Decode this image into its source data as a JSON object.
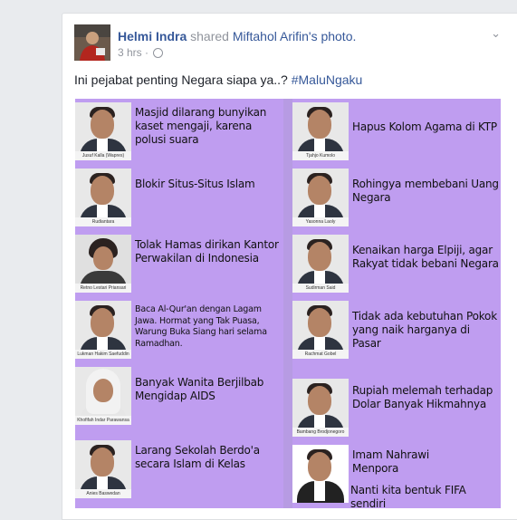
{
  "post": {
    "author": "Helmi Indra",
    "action": " shared ",
    "source_name": "Miftahol Arifin",
    "source_suffix": "'s photo.",
    "time": "3 hrs",
    "meta_sep": " · ",
    "caption": "Ini pejabat penting Negara siapa ya..? ",
    "hashtag": "#MaluNgaku"
  },
  "left_column": [
    {
      "caption": "Jusuf Kalla (Wapres)",
      "text": "Masjid dilarang bunyikan kaset mengaji, karena polusi suara"
    },
    {
      "caption": "Rudiantara",
      "text": "Blokir Situs-Situs Islam"
    },
    {
      "caption": "Retno Lestari Priansari Marsudi",
      "text": "Tolak Hamas dirikan Kantor Perwakilan di Indonesia"
    },
    {
      "caption": "Lukman Hakim Saefuddin",
      "text": "Baca Al-Qur'an dengan Lagam Jawa. Hormat yang Tak Puasa, Warung Buka Siang hari selama Ramadhan."
    },
    {
      "caption": "Khofifah Indar Parawansa",
      "text": "Banyak Wanita Berjilbab Mengidap AIDS"
    },
    {
      "caption": "Anies Baswedan",
      "text": "Larang Sekolah Berdo'a secara Islam di Kelas"
    }
  ],
  "right_column": [
    {
      "caption": "Tjahjo Kumolo",
      "text": "Hapus Kolom Agama di KTP"
    },
    {
      "caption": "Yasonna Laoly",
      "text": "Rohingya membebani Uang Negara"
    },
    {
      "caption": "Sudirman Said",
      "text": "Kenaikan harga Elpiji, agar Rakyat tidak bebani Negara"
    },
    {
      "caption": "Rachmat Gobel",
      "text": "Tidak ada kebutuhan Pokok yang naik harganya di Pasar"
    },
    {
      "caption": "Bambang Brodjonegoro",
      "text": "Rupiah melemah terhadap Dolar Banyak Hikmahnya"
    },
    {
      "caption": "",
      "text": "Imam Nahrawi Menpora",
      "text2": "Nanti kita bentuk FIFA sendiri"
    }
  ],
  "icons": {
    "more": "chevron-down-icon",
    "privacy": "globe-icon"
  },
  "colors": {
    "link": "#365899",
    "panel": "#bf9df0",
    "meta": "#90949c"
  }
}
